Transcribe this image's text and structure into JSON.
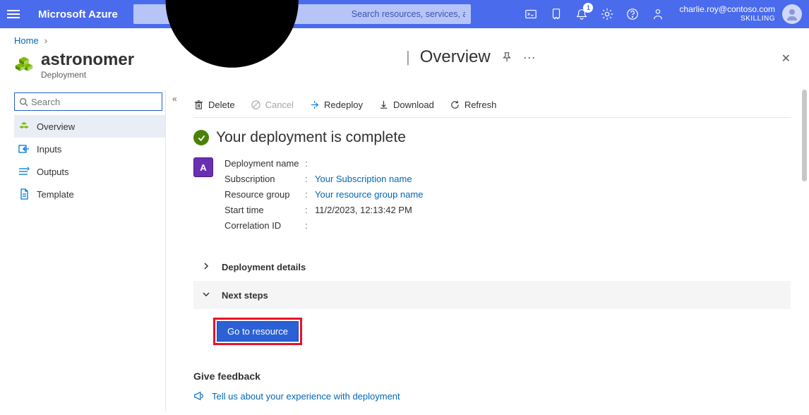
{
  "header": {
    "brand": "Microsoft Azure",
    "search_placeholder": "Search resources, services, and docs (G+/)",
    "notification_count": "1",
    "user_email": "charlie.roy@contoso.com",
    "tenant": "SKILLING"
  },
  "breadcrumb": {
    "home": "Home"
  },
  "resource": {
    "name": "astronomer",
    "type": "Deployment",
    "section": "Overview"
  },
  "sidebar": {
    "search_placeholder": "Search",
    "items": [
      "Overview",
      "Inputs",
      "Outputs",
      "Template"
    ]
  },
  "commands": {
    "delete": "Delete",
    "cancel": "Cancel",
    "redeploy": "Redeploy",
    "download": "Download",
    "refresh": "Refresh"
  },
  "status": {
    "title": "Your deployment is complete"
  },
  "details": {
    "deployment_name_label": "Deployment name",
    "deployment_name": "",
    "subscription_label": "Subscription",
    "subscription": "Your Subscription name",
    "resource_group_label": "Resource group",
    "resource_group": "Your resource group name",
    "start_time_label": "Start time",
    "start_time": "11/2/2023, 12:13:42 PM",
    "correlation_label": "Correlation ID",
    "correlation": ""
  },
  "accordion": {
    "deployment_details": "Deployment details",
    "next_steps": "Next steps",
    "go_to_resource": "Go to resource"
  },
  "feedback": {
    "heading": "Give feedback",
    "link": "Tell us about your experience with deployment"
  }
}
